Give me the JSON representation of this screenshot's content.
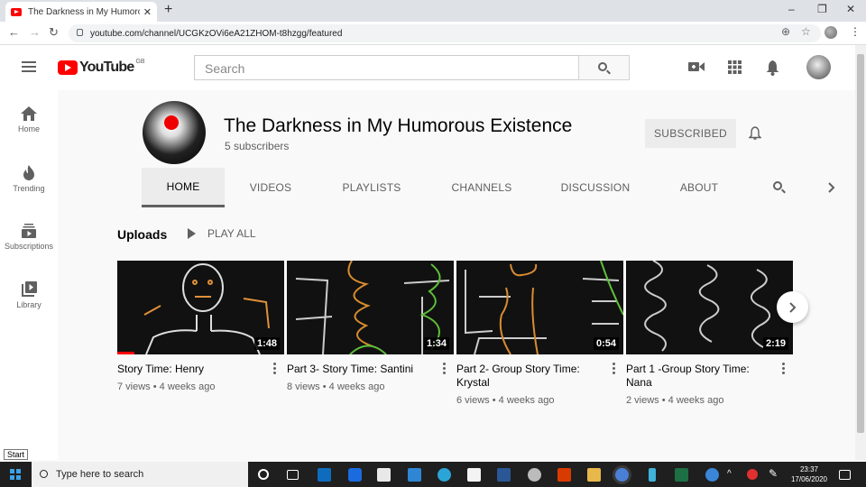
{
  "browser": {
    "tab_title": "The Darkness in My Humorous E",
    "tab_close": "✕",
    "new_tab": "+",
    "url": "youtube.com/channel/UCGKzOVi6eA21ZHOM-t8hzgg/featured",
    "win_minimize": "–",
    "win_restore": "❐",
    "win_close": "✕"
  },
  "header": {
    "logo_text": "YouTube",
    "region": "GB",
    "search_placeholder": "Search"
  },
  "leftnav": {
    "items": [
      {
        "label": "Home",
        "icon": "home-icon"
      },
      {
        "label": "Trending",
        "icon": "flame-icon"
      },
      {
        "label": "Subscriptions",
        "icon": "subscriptions-icon"
      },
      {
        "label": "Library",
        "icon": "library-icon"
      }
    ]
  },
  "channel": {
    "name": "The Darkness in My Humorous Existence",
    "subscribers": "5 subscribers",
    "subscribe_label": "SUBSCRIBED",
    "tabs": [
      "HOME",
      "VIDEOS",
      "PLAYLISTS",
      "CHANNELS",
      "DISCUSSION",
      "ABOUT"
    ],
    "active_tab": "HOME"
  },
  "section": {
    "title": "Uploads",
    "play_all": "PLAY ALL"
  },
  "videos": [
    {
      "title": "Story Time: Henry",
      "views": "7 views",
      "age": "4 weeks ago",
      "duration": "1:48",
      "watched_fraction": 0.1
    },
    {
      "title": "Part 3- Story Time: Santini",
      "views": "8 views",
      "age": "4 weeks ago",
      "duration": "1:34"
    },
    {
      "title": "Part 2- Group Story Time: Krystal",
      "views": "6 views",
      "age": "4 weeks ago",
      "duration": "0:54"
    },
    {
      "title": "Part 1 -Group Story Time: Nana",
      "views": "2 views",
      "age": "4 weeks ago",
      "duration": "2:19"
    }
  ],
  "meta_separator": "•",
  "taskbar": {
    "start_tooltip": "Start",
    "search_placeholder": "Type here to search",
    "time": "23:37",
    "date": "17/06/2020"
  },
  "colors": {
    "brand_red": "#ff0000",
    "taskbar": "#1f1f1f"
  }
}
